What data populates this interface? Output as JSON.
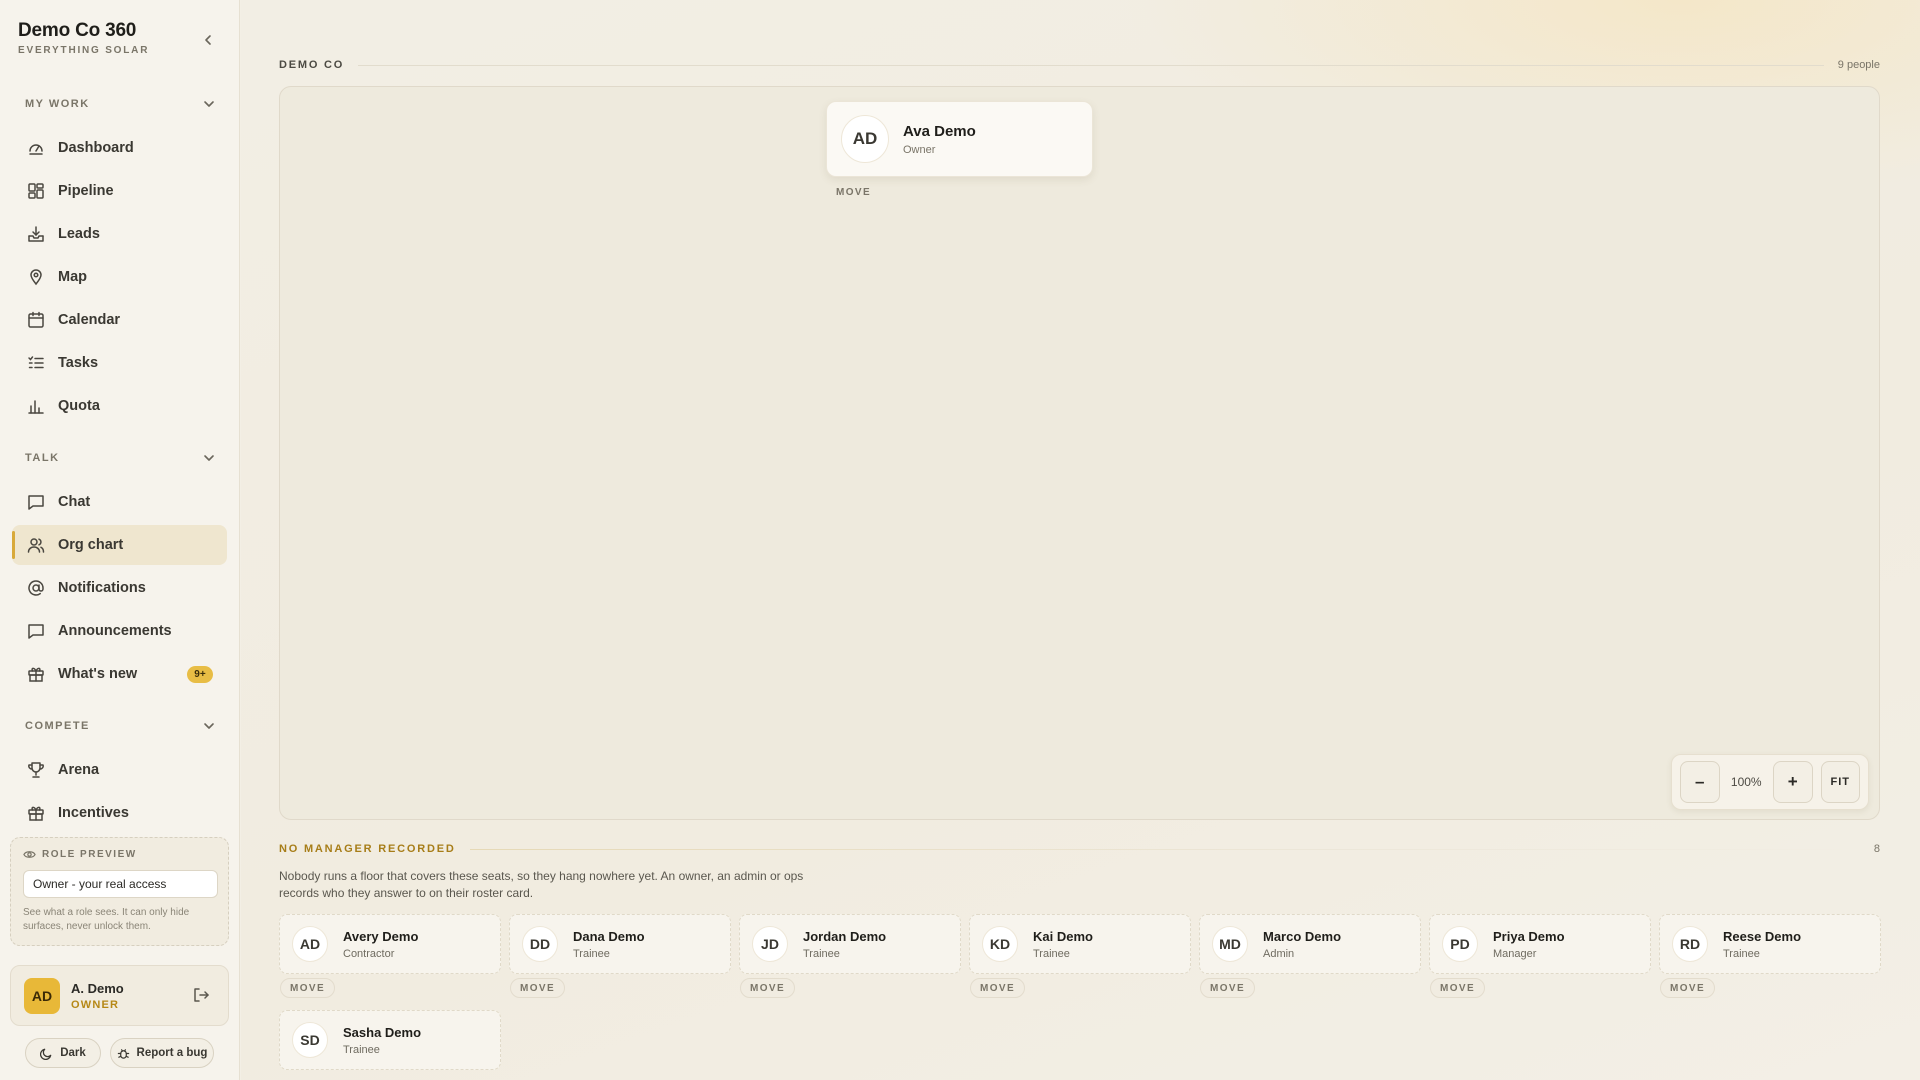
{
  "brand": {
    "title": "Demo Co 360",
    "subtitle": "EVERYTHING SOLAR"
  },
  "sections": {
    "my_work": "MY WORK",
    "talk": "TALK",
    "compete": "COMPETE"
  },
  "nav": {
    "dashboard": "Dashboard",
    "pipeline": "Pipeline",
    "leads": "Leads",
    "map": "Map",
    "calendar": "Calendar",
    "tasks": "Tasks",
    "quota": "Quota",
    "chat": "Chat",
    "org_chart": "Org chart",
    "notifications": "Notifications",
    "announcements": "Announcements",
    "whats_new": "What's new",
    "whats_new_badge": "9+",
    "arena": "Arena",
    "incentives": "Incentives"
  },
  "role_preview": {
    "label": "ROLE PREVIEW",
    "selected": "Owner - your real access",
    "hint": "See what a role sees. It can only hide surfaces, never unlock them."
  },
  "user": {
    "initials": "AD",
    "name": "A. Demo",
    "role": "OWNER"
  },
  "footer": {
    "dark": "Dark",
    "bug": "Report a bug"
  },
  "org": {
    "label": "DEMO CO",
    "count": "9 people",
    "root": {
      "initials": "AD",
      "name": "Ava Demo",
      "role": "Owner",
      "move": "MOVE"
    },
    "zoom": {
      "minus": "–",
      "value": "100%",
      "plus": "+",
      "fit": "FIT"
    }
  },
  "no_manager": {
    "label": "NO MANAGER RECORDED",
    "count": "8",
    "description": "Nobody runs a floor that covers these seats, so they hang nowhere yet. An owner, an admin or ops records who they answer to on their roster card.",
    "move": "MOVE",
    "people": [
      {
        "initials": "AD",
        "name": "Avery Demo",
        "role": "Contractor"
      },
      {
        "initials": "DD",
        "name": "Dana Demo",
        "role": "Trainee"
      },
      {
        "initials": "JD",
        "name": "Jordan Demo",
        "role": "Trainee"
      },
      {
        "initials": "KD",
        "name": "Kai Demo",
        "role": "Trainee"
      },
      {
        "initials": "MD",
        "name": "Marco Demo",
        "role": "Admin"
      },
      {
        "initials": "PD",
        "name": "Priya Demo",
        "role": "Manager"
      },
      {
        "initials": "RD",
        "name": "Reese Demo",
        "role": "Trainee"
      },
      {
        "initials": "SD",
        "name": "Sasha Demo",
        "role": "Trainee"
      }
    ]
  }
}
